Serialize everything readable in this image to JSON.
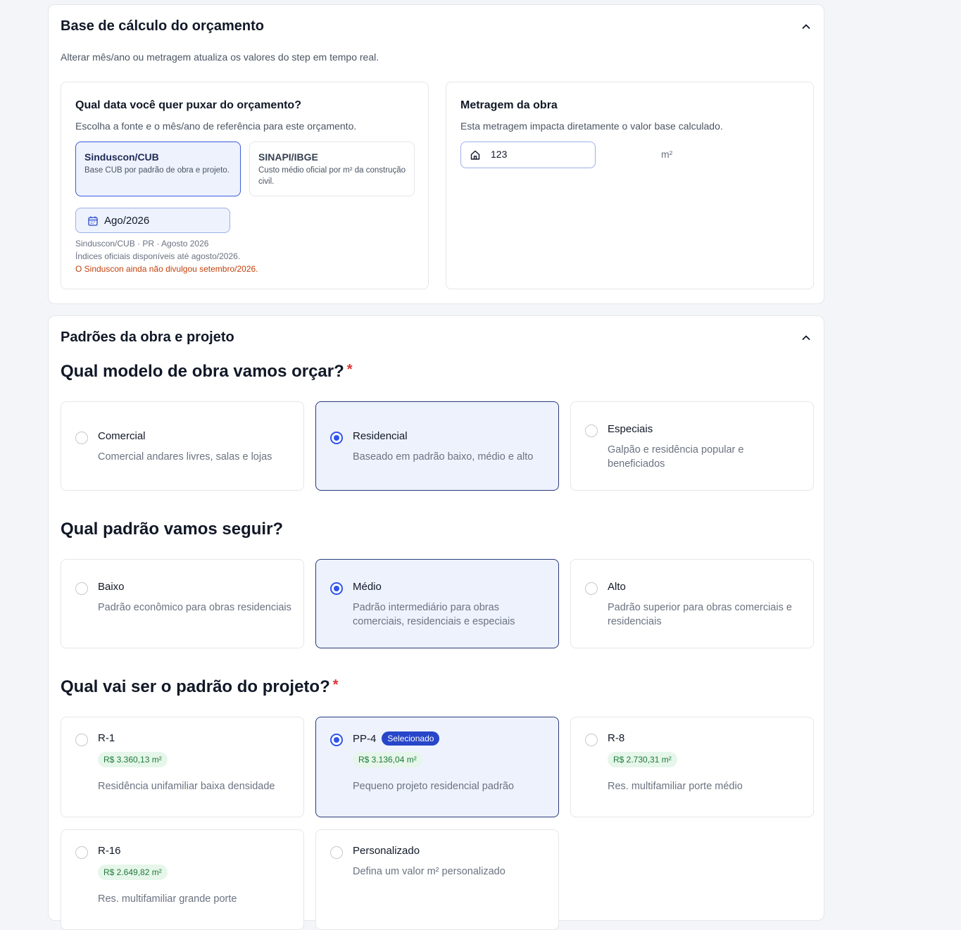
{
  "base": {
    "title": "Base de cálculo do orçamento",
    "description": "Alterar mês/ano ou metragem atualiza os valores do step em tempo real.",
    "date_panel": {
      "title": "Qual data você quer puxar do orçamento?",
      "description": "Escolha a fonte e o mês/ano de referência para este orçamento.",
      "sources": [
        {
          "title": "Sinduscon/CUB",
          "description": "Base CUB por padrão de obra e projeto.",
          "selected": true
        },
        {
          "title": "SINAPI/IBGE",
          "description": "Custo médio oficial por m² da construção civil.",
          "selected": false
        }
      ],
      "month_value": "Ago/2026",
      "notes": [
        "Sinduscon/CUB · PR · Agosto 2026",
        "Índices oficiais disponíveis até agosto/2026.",
        "O Sinduscon ainda não divulgou setembro/2026."
      ]
    },
    "area_panel": {
      "title": "Metragem da obra",
      "description": "Esta metragem impacta diretamente o valor base calculado.",
      "value": "123",
      "unit": "m²"
    }
  },
  "padroes": {
    "title": "Padrões da obra e projeto",
    "q_modelo": {
      "question": "Qual modelo de obra vamos orçar?",
      "required_mark": "*",
      "options": [
        {
          "title": "Comercial",
          "description": "Comercial andares livres, salas e lojas",
          "selected": false
        },
        {
          "title": "Residencial",
          "description": "Baseado em padrão baixo, médio e alto",
          "selected": true
        },
        {
          "title": "Especiais",
          "description": "Galpão e residência popular e beneficiados",
          "selected": false
        }
      ]
    },
    "q_padrao": {
      "question": "Qual padrão vamos seguir?",
      "options": [
        {
          "title": "Baixo",
          "description": "Padrão econômico para obras residenciais",
          "selected": false
        },
        {
          "title": "Médio",
          "description": "Padrão intermediário para obras comerciais, residenciais e especiais",
          "selected": true
        },
        {
          "title": "Alto",
          "description": "Padrão superior para obras comerciais e residenciais",
          "selected": false
        }
      ]
    },
    "q_projeto": {
      "question": "Qual vai ser o padrão do projeto?",
      "required_mark": "*",
      "selected_badge": "Selecionado",
      "options": [
        {
          "title": "R-1",
          "price": "R$ 3.360,13 m²",
          "description": "Residência unifamiliar baixa densidade",
          "selected": false
        },
        {
          "title": "PP-4",
          "price": "R$ 3.136,04 m²",
          "description": "Pequeno projeto residencial padrão",
          "selected": true
        },
        {
          "title": "R-8",
          "price": "R$ 2.730,31 m²",
          "description": "Res. multifamiliar porte médio",
          "selected": false
        },
        {
          "title": "R-16",
          "price": "R$ 2.649,82 m²",
          "description": "Res. multifamiliar grande porte",
          "selected": false
        },
        {
          "title": "Personalizado",
          "description": "Defina um valor m² personalizado",
          "selected": false
        }
      ]
    }
  }
}
